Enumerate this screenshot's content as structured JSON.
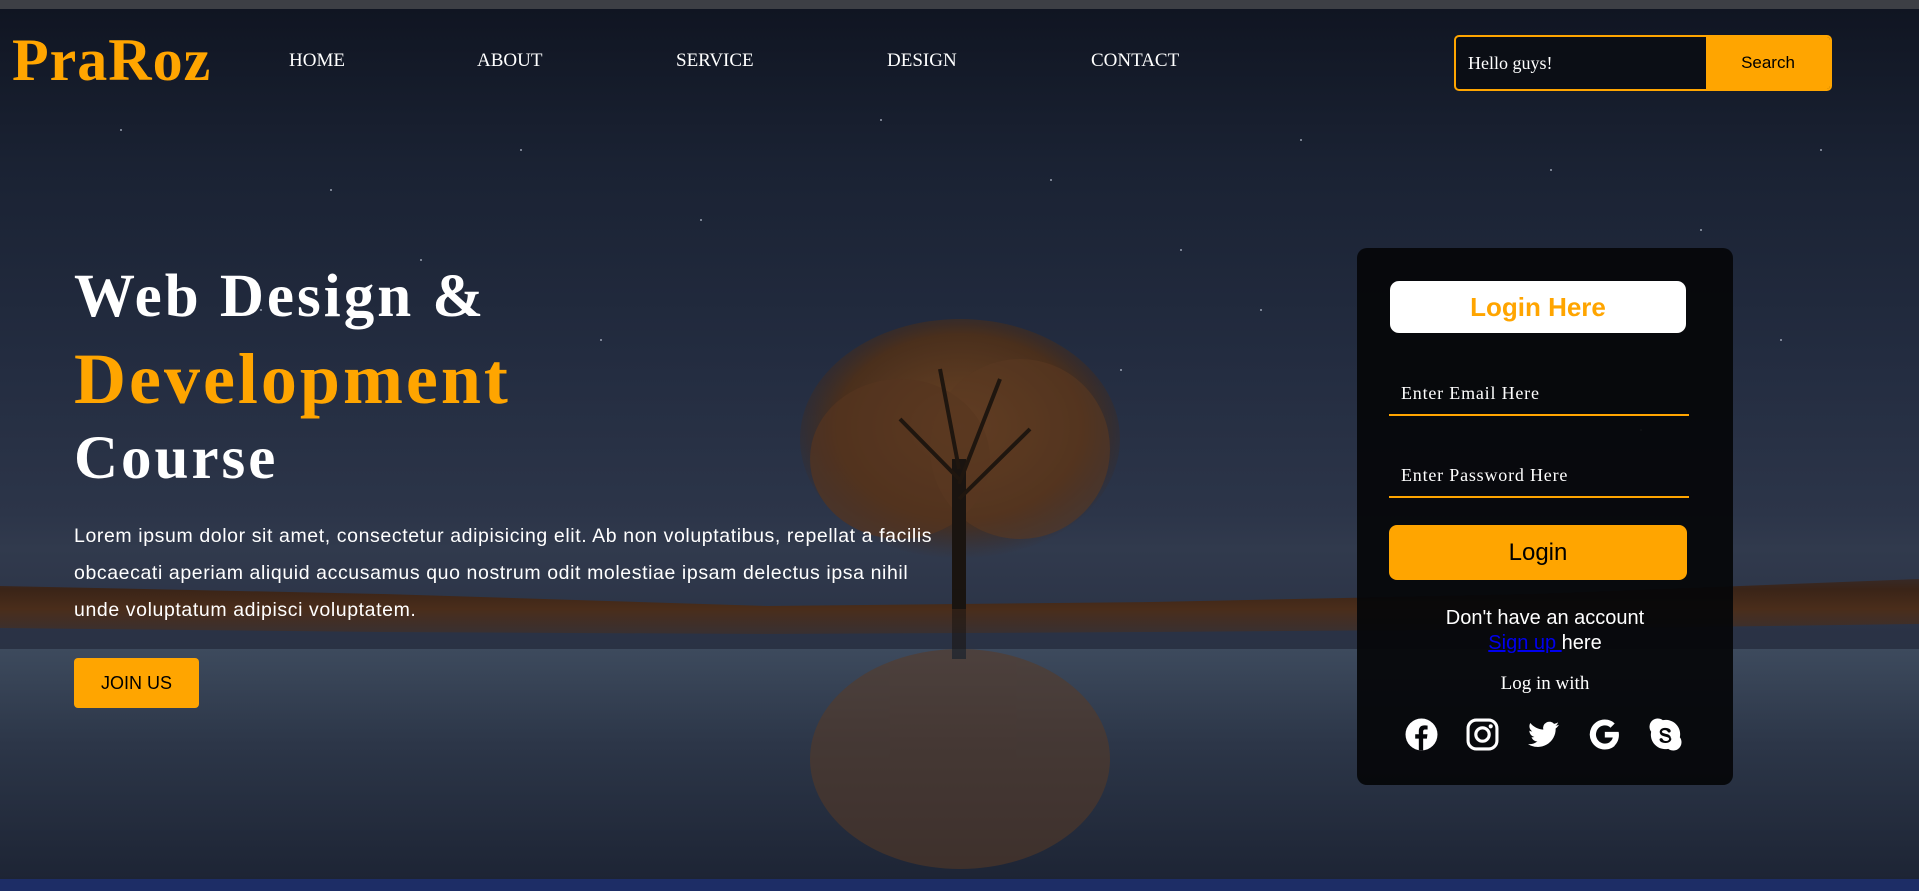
{
  "brand": {
    "logo": "PraRoz",
    "accent": "#ffa500"
  },
  "nav": [
    {
      "label": "HOME"
    },
    {
      "label": "ABOUT"
    },
    {
      "label": "SERVICE"
    },
    {
      "label": "DESIGN"
    },
    {
      "label": "CONTACT"
    }
  ],
  "search": {
    "value": "Hello guys!",
    "button": "Search"
  },
  "hero": {
    "line1": "Web Design &",
    "line2": "Development",
    "line3": "Course",
    "paragraph": "Lorem ipsum dolor sit amet, consectetur adipisicing elit. Ab non voluptatibus, repellat a facilis obcaecati aperiam aliquid accusamus quo nostrum odit molestiae ipsam delectus ipsa nihil unde voluptatum adipisci voluptatem.",
    "cta": "JOIN US"
  },
  "login": {
    "title": "Login Here",
    "email_placeholder": "Enter Email Here",
    "password_placeholder": "Enter Password Here",
    "button": "Login",
    "no_account": "Don't have an account",
    "signup_link": "Sign up ",
    "signup_suffix": "here",
    "log_in_with": "Log in with",
    "socials": [
      "facebook-icon",
      "instagram-icon",
      "twitter-icon",
      "google-icon",
      "skype-icon"
    ]
  }
}
